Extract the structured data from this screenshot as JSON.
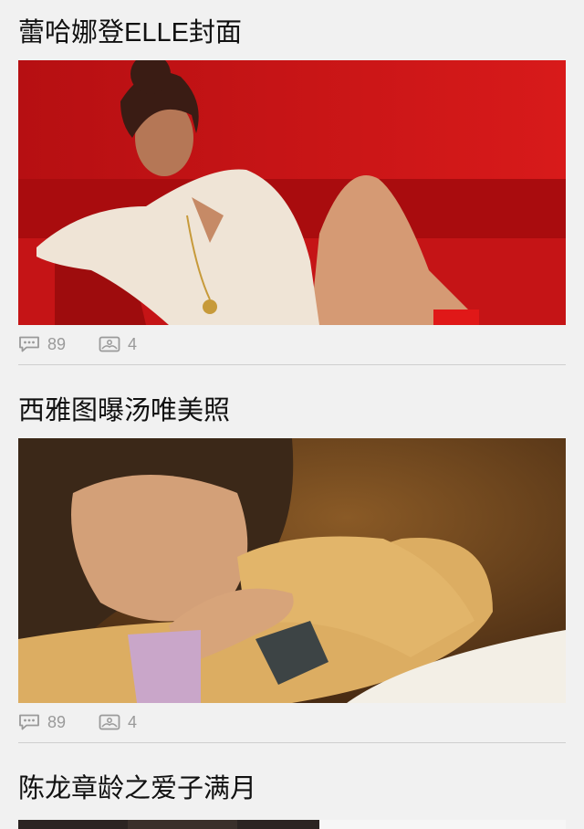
{
  "feed": {
    "items": [
      {
        "title": "蕾哈娜登ELLE封面",
        "comments": "89",
        "photos": "4",
        "image_icon": "photo-thumbnail"
      },
      {
        "title": "西雅图曝汤唯美照",
        "comments": "89",
        "photos": "4",
        "image_icon": "photo-thumbnail"
      },
      {
        "title": "陈龙章龄之爱子满月",
        "image_icon": "photo-thumbnail"
      }
    ],
    "icons": {
      "comment": "comment-bubble-icon",
      "photos": "photo-gallery-icon"
    },
    "colors": {
      "background": "#f1f1f1",
      "meta_text": "#9a9a9a",
      "divider": "#cfcfcf"
    }
  }
}
